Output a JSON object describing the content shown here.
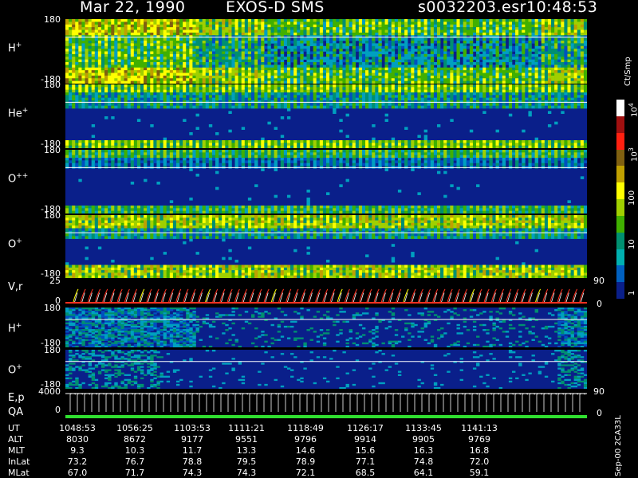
{
  "header": {
    "date": "Mar 22, 1990",
    "instrument": "EXOS-D SMS",
    "file": "s0032203.esr",
    "time": "10:48:53"
  },
  "colorbar": {
    "units": "Ct/Smp",
    "labels": [
      "10",
      "3",
      "10",
      "4",
      "100",
      "10",
      "1"
    ],
    "label_exp_1": "3",
    "label_exp_2": "4",
    "colors": [
      "#ffffff",
      "#a01010",
      "#ff2010",
      "#806010",
      "#c0a000",
      "#ffff00",
      "#a0d000",
      "#40b000",
      "#009070",
      "#00b0b0",
      "#0060c0",
      "#0a1f8a"
    ]
  },
  "panels": [
    {
      "label": "H",
      "charge": "+",
      "ymax": "180",
      "ymin": "-180"
    },
    {
      "label": "He",
      "charge": "+",
      "ymax": "180",
      "ymin": "-180"
    },
    {
      "label": "O",
      "charge": "++",
      "ymax": "180",
      "ymin": "-180"
    },
    {
      "label": "O",
      "charge": "+",
      "ymax": "180",
      "ymin": "-180"
    },
    {
      "label": "V,r",
      "charge": "",
      "ymax": "25",
      "ymin": "0",
      "rmax": "90",
      "rmin": "0"
    },
    {
      "label": "H",
      "charge": "+",
      "ymax": "180",
      "ymin": "-180"
    },
    {
      "label": "O",
      "charge": "+",
      "ymax": "180",
      "ymin": "-180"
    },
    {
      "label": "E,p",
      "charge": "",
      "ymax": "4000",
      "ymin": "0",
      "rmax": "90",
      "rmin": "0"
    },
    {
      "label": "QA",
      "charge": ""
    }
  ],
  "ephemeris": {
    "rows": [
      {
        "name": "UT",
        "values": [
          "1048:53",
          "1056:25",
          "1103:53",
          "1111:21",
          "1118:49",
          "1126:17",
          "1133:45",
          "1141:13"
        ]
      },
      {
        "name": "ALT",
        "values": [
          "8030",
          "8672",
          "9177",
          "9551",
          "9796",
          "9914",
          "9905",
          "9769"
        ]
      },
      {
        "name": "MLT",
        "values": [
          "9.3",
          "10.3",
          "11.7",
          "13.3",
          "14.6",
          "15.6",
          "16.3",
          "16.8"
        ]
      },
      {
        "name": "InLat",
        "values": [
          "73.2",
          "76.7",
          "78.8",
          "79.5",
          "78.9",
          "77.1",
          "74.8",
          "72.0"
        ]
      },
      {
        "name": "MLat",
        "values": [
          "67.0",
          "71.7",
          "74.3",
          "74.3",
          "72.1",
          "68.5",
          "64.1",
          "59.1"
        ]
      }
    ]
  },
  "footer": {
    "version": "Sep-00 2CA33L"
  },
  "chart_data": {
    "type": "heatmap",
    "title": "Mar 22, 1990 EXOS-D SMS",
    "x": [
      "1048:53",
      "1056:25",
      "1103:53",
      "1111:21",
      "1118:49",
      "1126:17",
      "1133:45",
      "1141:13"
    ],
    "panels": [
      "H+",
      "He+",
      "O++",
      "O+",
      "V,r",
      "H+",
      "O+",
      "E,p",
      "QA"
    ],
    "colorbar_label": "Ct/Smp",
    "colorbar_range": [
      1,
      10000
    ],
    "log_scale": true
  }
}
